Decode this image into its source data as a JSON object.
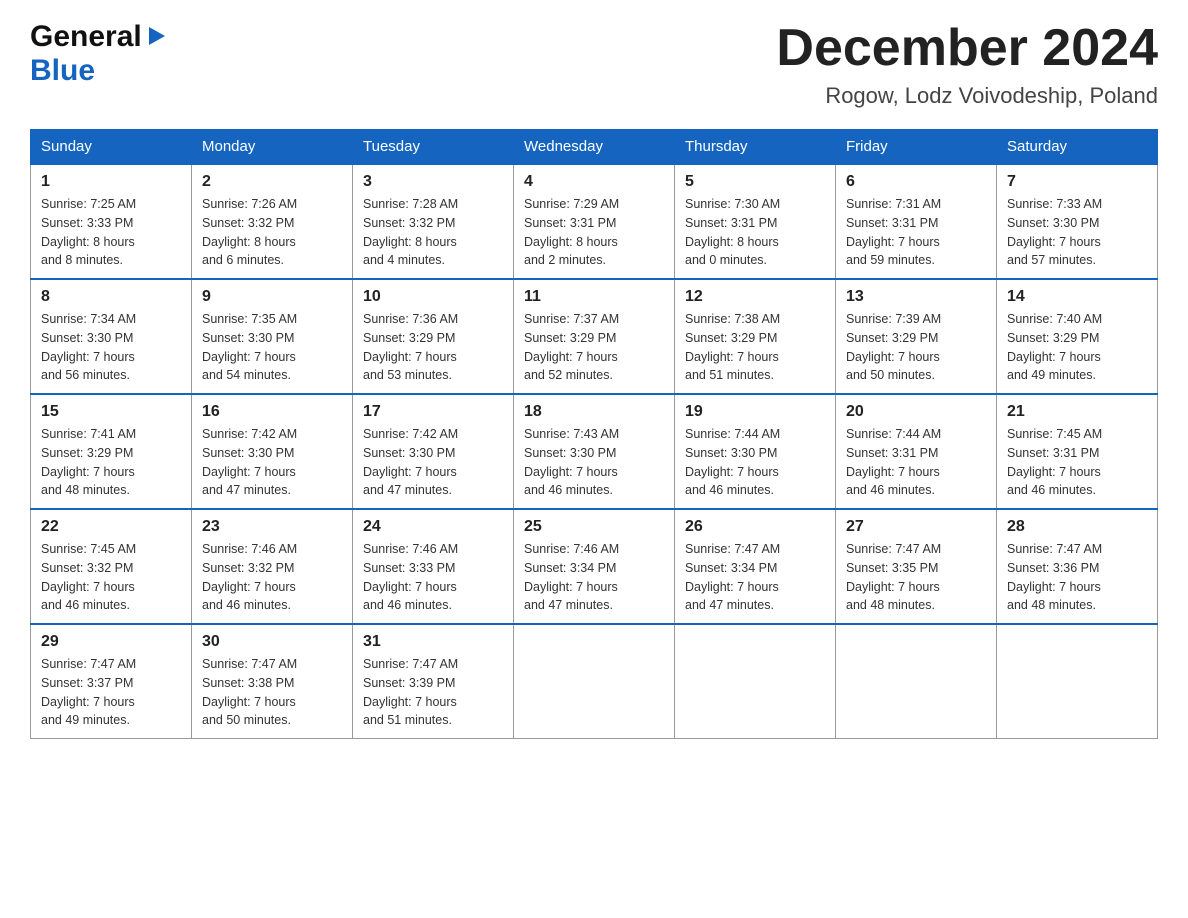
{
  "header": {
    "logo_general": "General",
    "logo_blue": "Blue",
    "title": "December 2024",
    "subtitle": "Rogow, Lodz Voivodeship, Poland"
  },
  "calendar": {
    "days_of_week": [
      "Sunday",
      "Monday",
      "Tuesday",
      "Wednesday",
      "Thursday",
      "Friday",
      "Saturday"
    ],
    "weeks": [
      [
        {
          "day": "1",
          "sunrise": "7:25 AM",
          "sunset": "3:33 PM",
          "daylight": "8 hours and 8 minutes."
        },
        {
          "day": "2",
          "sunrise": "7:26 AM",
          "sunset": "3:32 PM",
          "daylight": "8 hours and 6 minutes."
        },
        {
          "day": "3",
          "sunrise": "7:28 AM",
          "sunset": "3:32 PM",
          "daylight": "8 hours and 4 minutes."
        },
        {
          "day": "4",
          "sunrise": "7:29 AM",
          "sunset": "3:31 PM",
          "daylight": "8 hours and 2 minutes."
        },
        {
          "day": "5",
          "sunrise": "7:30 AM",
          "sunset": "3:31 PM",
          "daylight": "8 hours and 0 minutes."
        },
        {
          "day": "6",
          "sunrise": "7:31 AM",
          "sunset": "3:31 PM",
          "daylight": "7 hours and 59 minutes."
        },
        {
          "day": "7",
          "sunrise": "7:33 AM",
          "sunset": "3:30 PM",
          "daylight": "7 hours and 57 minutes."
        }
      ],
      [
        {
          "day": "8",
          "sunrise": "7:34 AM",
          "sunset": "3:30 PM",
          "daylight": "7 hours and 56 minutes."
        },
        {
          "day": "9",
          "sunrise": "7:35 AM",
          "sunset": "3:30 PM",
          "daylight": "7 hours and 54 minutes."
        },
        {
          "day": "10",
          "sunrise": "7:36 AM",
          "sunset": "3:29 PM",
          "daylight": "7 hours and 53 minutes."
        },
        {
          "day": "11",
          "sunrise": "7:37 AM",
          "sunset": "3:29 PM",
          "daylight": "7 hours and 52 minutes."
        },
        {
          "day": "12",
          "sunrise": "7:38 AM",
          "sunset": "3:29 PM",
          "daylight": "7 hours and 51 minutes."
        },
        {
          "day": "13",
          "sunrise": "7:39 AM",
          "sunset": "3:29 PM",
          "daylight": "7 hours and 50 minutes."
        },
        {
          "day": "14",
          "sunrise": "7:40 AM",
          "sunset": "3:29 PM",
          "daylight": "7 hours and 49 minutes."
        }
      ],
      [
        {
          "day": "15",
          "sunrise": "7:41 AM",
          "sunset": "3:29 PM",
          "daylight": "7 hours and 48 minutes."
        },
        {
          "day": "16",
          "sunrise": "7:42 AM",
          "sunset": "3:30 PM",
          "daylight": "7 hours and 47 minutes."
        },
        {
          "day": "17",
          "sunrise": "7:42 AM",
          "sunset": "3:30 PM",
          "daylight": "7 hours and 47 minutes."
        },
        {
          "day": "18",
          "sunrise": "7:43 AM",
          "sunset": "3:30 PM",
          "daylight": "7 hours and 46 minutes."
        },
        {
          "day": "19",
          "sunrise": "7:44 AM",
          "sunset": "3:30 PM",
          "daylight": "7 hours and 46 minutes."
        },
        {
          "day": "20",
          "sunrise": "7:44 AM",
          "sunset": "3:31 PM",
          "daylight": "7 hours and 46 minutes."
        },
        {
          "day": "21",
          "sunrise": "7:45 AM",
          "sunset": "3:31 PM",
          "daylight": "7 hours and 46 minutes."
        }
      ],
      [
        {
          "day": "22",
          "sunrise": "7:45 AM",
          "sunset": "3:32 PM",
          "daylight": "7 hours and 46 minutes."
        },
        {
          "day": "23",
          "sunrise": "7:46 AM",
          "sunset": "3:32 PM",
          "daylight": "7 hours and 46 minutes."
        },
        {
          "day": "24",
          "sunrise": "7:46 AM",
          "sunset": "3:33 PM",
          "daylight": "7 hours and 46 minutes."
        },
        {
          "day": "25",
          "sunrise": "7:46 AM",
          "sunset": "3:34 PM",
          "daylight": "7 hours and 47 minutes."
        },
        {
          "day": "26",
          "sunrise": "7:47 AM",
          "sunset": "3:34 PM",
          "daylight": "7 hours and 47 minutes."
        },
        {
          "day": "27",
          "sunrise": "7:47 AM",
          "sunset": "3:35 PM",
          "daylight": "7 hours and 48 minutes."
        },
        {
          "day": "28",
          "sunrise": "7:47 AM",
          "sunset": "3:36 PM",
          "daylight": "7 hours and 48 minutes."
        }
      ],
      [
        {
          "day": "29",
          "sunrise": "7:47 AM",
          "sunset": "3:37 PM",
          "daylight": "7 hours and 49 minutes."
        },
        {
          "day": "30",
          "sunrise": "7:47 AM",
          "sunset": "3:38 PM",
          "daylight": "7 hours and 50 minutes."
        },
        {
          "day": "31",
          "sunrise": "7:47 AM",
          "sunset": "3:39 PM",
          "daylight": "7 hours and 51 minutes."
        },
        null,
        null,
        null,
        null
      ]
    ],
    "labels": {
      "sunrise": "Sunrise:",
      "sunset": "Sunset:",
      "daylight": "Daylight:"
    }
  }
}
